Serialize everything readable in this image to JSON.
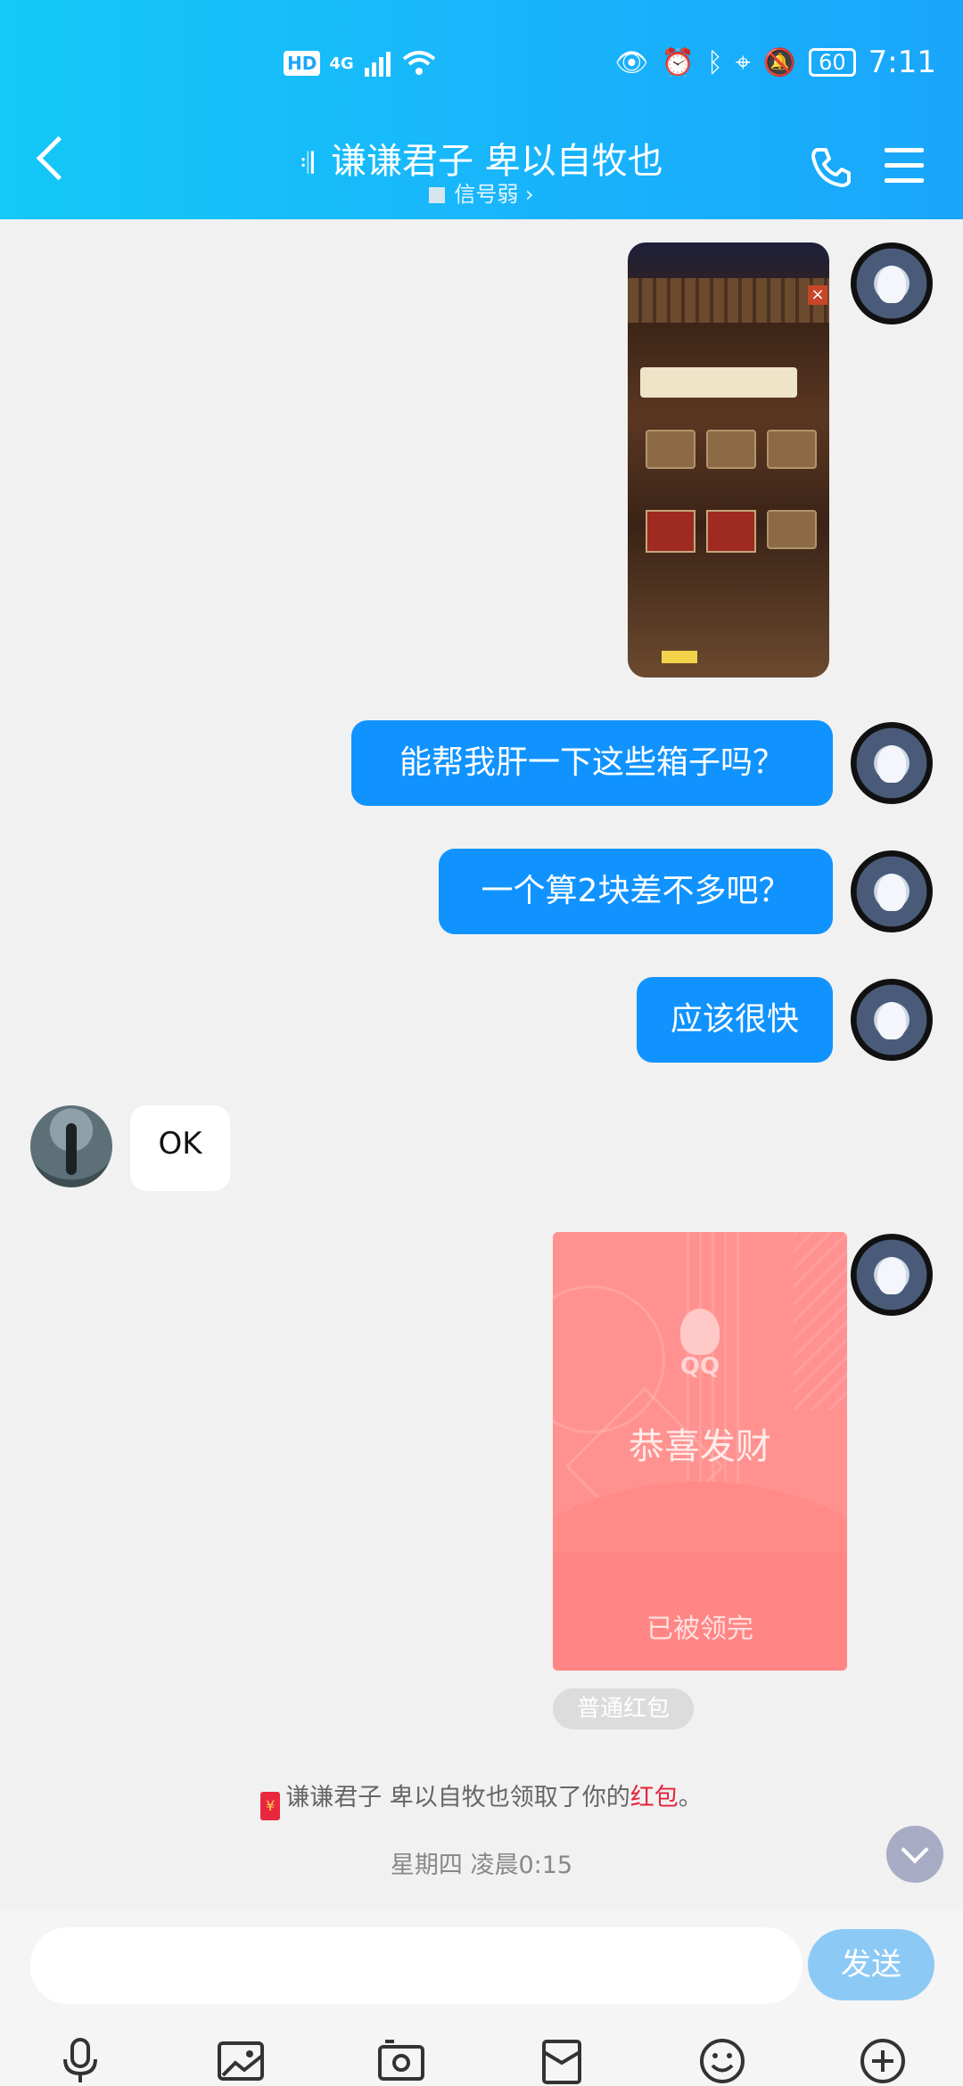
{
  "status_bar": {
    "left": {
      "hd": "HD",
      "network": "4G"
    },
    "right": {
      "battery": "60",
      "time": "7:11"
    },
    "icons": [
      "wifi-icon",
      "eye-icon",
      "alarm-icon",
      "bluetooth-icon",
      "location-icon",
      "mute-icon",
      "battery-icon"
    ]
  },
  "header": {
    "title": "谦谦君子   卑以自牧也",
    "subtitle": "信号弱 ›",
    "icons": [
      "back-icon",
      "ear-icon",
      "phone-icon",
      "menu-icon"
    ]
  },
  "messages": [
    {
      "type": "image",
      "direction": "out"
    },
    {
      "type": "text",
      "direction": "out",
      "text": "能帮我肝一下这些箱子吗？"
    },
    {
      "type": "text",
      "direction": "out",
      "text": "一个算2块差不多吧？"
    },
    {
      "type": "text",
      "direction": "out",
      "text": "应该很快"
    },
    {
      "type": "text",
      "direction": "in",
      "text": "OK"
    },
    {
      "type": "red_packet",
      "direction": "out",
      "brand": "QQ",
      "title": "恭喜发财",
      "status": "已被领完",
      "packet_type": "普通红包"
    }
  ],
  "system_message": {
    "icon_text": "¥",
    "name": "谦谦君子   卑以自牧也",
    "middle": "领取了你的",
    "link": "红包",
    "end": "。"
  },
  "timestamp": "星期四 凌晨0:15",
  "input": {
    "placeholder": "",
    "send_label": "发送"
  },
  "toolbar": [
    "mic-icon",
    "image-icon",
    "camera-icon",
    "file-icon",
    "emoji-icon",
    "plus-icon"
  ],
  "colors": {
    "header": "#18b6fb",
    "bubble_out": "#1193ff",
    "red_packet": "#ff9290",
    "hb_link": "#e3233a"
  }
}
